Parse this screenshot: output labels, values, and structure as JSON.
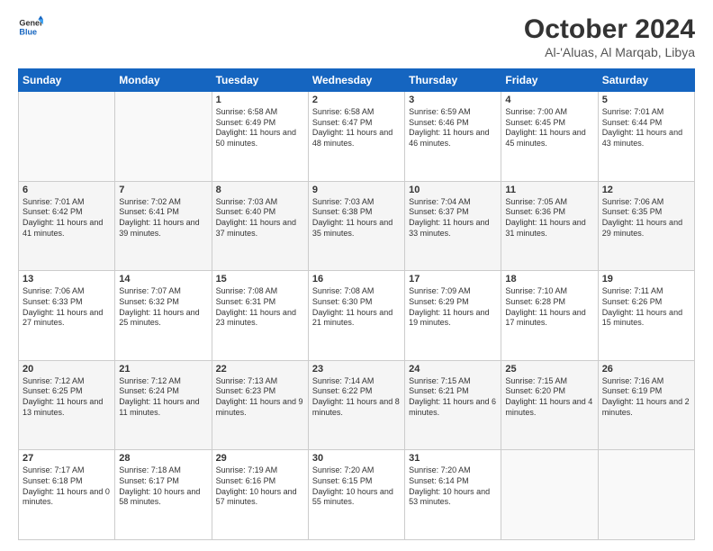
{
  "logo": {
    "line1": "General",
    "line2": "Blue"
  },
  "title": "October 2024",
  "location": "Al-'Aluas, Al Marqab, Libya",
  "days_header": [
    "Sunday",
    "Monday",
    "Tuesday",
    "Wednesday",
    "Thursday",
    "Friday",
    "Saturday"
  ],
  "weeks": [
    [
      {
        "day": "",
        "content": ""
      },
      {
        "day": "",
        "content": ""
      },
      {
        "day": "1",
        "content": "Sunrise: 6:58 AM\nSunset: 6:49 PM\nDaylight: 11 hours and 50 minutes."
      },
      {
        "day": "2",
        "content": "Sunrise: 6:58 AM\nSunset: 6:47 PM\nDaylight: 11 hours and 48 minutes."
      },
      {
        "day": "3",
        "content": "Sunrise: 6:59 AM\nSunset: 6:46 PM\nDaylight: 11 hours and 46 minutes."
      },
      {
        "day": "4",
        "content": "Sunrise: 7:00 AM\nSunset: 6:45 PM\nDaylight: 11 hours and 45 minutes."
      },
      {
        "day": "5",
        "content": "Sunrise: 7:01 AM\nSunset: 6:44 PM\nDaylight: 11 hours and 43 minutes."
      }
    ],
    [
      {
        "day": "6",
        "content": "Sunrise: 7:01 AM\nSunset: 6:42 PM\nDaylight: 11 hours and 41 minutes."
      },
      {
        "day": "7",
        "content": "Sunrise: 7:02 AM\nSunset: 6:41 PM\nDaylight: 11 hours and 39 minutes."
      },
      {
        "day": "8",
        "content": "Sunrise: 7:03 AM\nSunset: 6:40 PM\nDaylight: 11 hours and 37 minutes."
      },
      {
        "day": "9",
        "content": "Sunrise: 7:03 AM\nSunset: 6:38 PM\nDaylight: 11 hours and 35 minutes."
      },
      {
        "day": "10",
        "content": "Sunrise: 7:04 AM\nSunset: 6:37 PM\nDaylight: 11 hours and 33 minutes."
      },
      {
        "day": "11",
        "content": "Sunrise: 7:05 AM\nSunset: 6:36 PM\nDaylight: 11 hours and 31 minutes."
      },
      {
        "day": "12",
        "content": "Sunrise: 7:06 AM\nSunset: 6:35 PM\nDaylight: 11 hours and 29 minutes."
      }
    ],
    [
      {
        "day": "13",
        "content": "Sunrise: 7:06 AM\nSunset: 6:33 PM\nDaylight: 11 hours and 27 minutes."
      },
      {
        "day": "14",
        "content": "Sunrise: 7:07 AM\nSunset: 6:32 PM\nDaylight: 11 hours and 25 minutes."
      },
      {
        "day": "15",
        "content": "Sunrise: 7:08 AM\nSunset: 6:31 PM\nDaylight: 11 hours and 23 minutes."
      },
      {
        "day": "16",
        "content": "Sunrise: 7:08 AM\nSunset: 6:30 PM\nDaylight: 11 hours and 21 minutes."
      },
      {
        "day": "17",
        "content": "Sunrise: 7:09 AM\nSunset: 6:29 PM\nDaylight: 11 hours and 19 minutes."
      },
      {
        "day": "18",
        "content": "Sunrise: 7:10 AM\nSunset: 6:28 PM\nDaylight: 11 hours and 17 minutes."
      },
      {
        "day": "19",
        "content": "Sunrise: 7:11 AM\nSunset: 6:26 PM\nDaylight: 11 hours and 15 minutes."
      }
    ],
    [
      {
        "day": "20",
        "content": "Sunrise: 7:12 AM\nSunset: 6:25 PM\nDaylight: 11 hours and 13 minutes."
      },
      {
        "day": "21",
        "content": "Sunrise: 7:12 AM\nSunset: 6:24 PM\nDaylight: 11 hours and 11 minutes."
      },
      {
        "day": "22",
        "content": "Sunrise: 7:13 AM\nSunset: 6:23 PM\nDaylight: 11 hours and 9 minutes."
      },
      {
        "day": "23",
        "content": "Sunrise: 7:14 AM\nSunset: 6:22 PM\nDaylight: 11 hours and 8 minutes."
      },
      {
        "day": "24",
        "content": "Sunrise: 7:15 AM\nSunset: 6:21 PM\nDaylight: 11 hours and 6 minutes."
      },
      {
        "day": "25",
        "content": "Sunrise: 7:15 AM\nSunset: 6:20 PM\nDaylight: 11 hours and 4 minutes."
      },
      {
        "day": "26",
        "content": "Sunrise: 7:16 AM\nSunset: 6:19 PM\nDaylight: 11 hours and 2 minutes."
      }
    ],
    [
      {
        "day": "27",
        "content": "Sunrise: 7:17 AM\nSunset: 6:18 PM\nDaylight: 11 hours and 0 minutes."
      },
      {
        "day": "28",
        "content": "Sunrise: 7:18 AM\nSunset: 6:17 PM\nDaylight: 10 hours and 58 minutes."
      },
      {
        "day": "29",
        "content": "Sunrise: 7:19 AM\nSunset: 6:16 PM\nDaylight: 10 hours and 57 minutes."
      },
      {
        "day": "30",
        "content": "Sunrise: 7:20 AM\nSunset: 6:15 PM\nDaylight: 10 hours and 55 minutes."
      },
      {
        "day": "31",
        "content": "Sunrise: 7:20 AM\nSunset: 6:14 PM\nDaylight: 10 hours and 53 minutes."
      },
      {
        "day": "",
        "content": ""
      },
      {
        "day": "",
        "content": ""
      }
    ]
  ]
}
